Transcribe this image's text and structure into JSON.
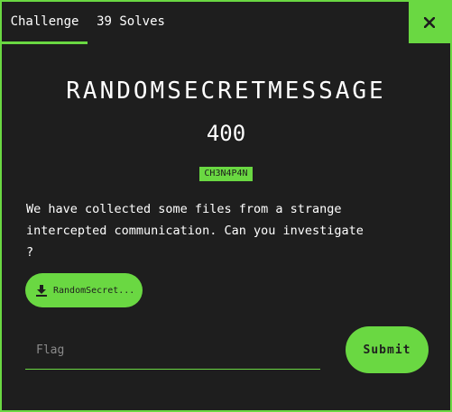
{
  "tabs": {
    "challenge": "Challenge",
    "solves": "39 Solves"
  },
  "challenge": {
    "name": "RANDOMSECRETMESSAGE",
    "points": "400",
    "tag": "CH3N4P4N",
    "description": "We have collected some files from a strange intercepted communication. Can you investigate ?",
    "file_label": "RandomSecret..."
  },
  "form": {
    "flag_placeholder": "Flag",
    "submit_label": "Submit"
  },
  "icons": {
    "close": "close-icon",
    "download": "download-icon"
  },
  "colors": {
    "accent": "#6ad842",
    "background": "#1e1e1e",
    "text": "#ffffff"
  }
}
